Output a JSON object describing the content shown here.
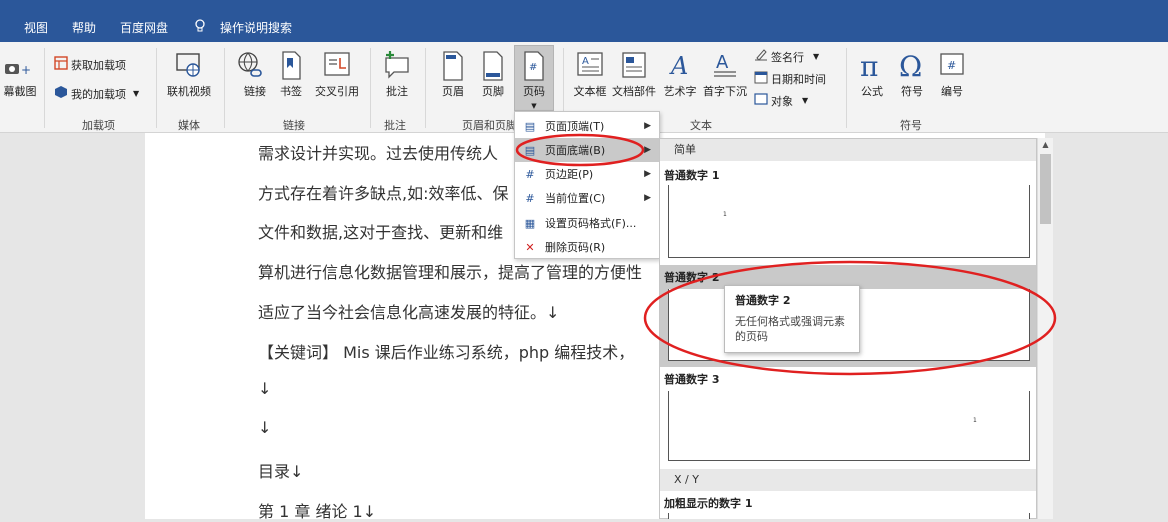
{
  "tabs": [
    "视图",
    "帮助",
    "百度网盘",
    "操作说明搜索"
  ],
  "ribbon": {
    "screenshot": "幕截图",
    "get_addins": "获取加载项",
    "my_addins": "我的加载项",
    "online_video": "联机视频",
    "link": "链接",
    "bookmark": "书签",
    "cross_ref": "交叉引用",
    "comment": "批注",
    "header": "页眉",
    "footer": "页脚",
    "page_number": "页码",
    "textbox": "文本框",
    "quick_parts": "文档部件",
    "wordart": "艺术字",
    "drop_cap": "首字下沉",
    "signature_line": "签名行",
    "datetime": "日期和时间",
    "object": "对象",
    "equation": "公式",
    "symbol": "符号",
    "number": "编号",
    "groups": {
      "addins": "加载项",
      "media": "媒体",
      "links": "链接",
      "comments": "批注",
      "header_footer": "页眉和页脚",
      "text": "文本",
      "symbols": "符号"
    }
  },
  "document": {
    "lines": [
      "需求设计并实现。过去使用传统人",
      "方式存在着许多缺点,如:效率低、保",
      "文件和数据,这对于查找、更新和维",
      "算机进行信息化数据管理和展示，提高了管理的方便性",
      "适应了当今社会信息化高速发展的特征。↓",
      "【关键词】  Mis 课后作业练习系统，php 编程技术，",
      "↓",
      "↓",
      "目录↓",
      "第 1 章  绪论 1↓"
    ]
  },
  "menu": {
    "items": [
      {
        "label": "页面顶端(T)",
        "submenu": true
      },
      {
        "label": "页面底端(B)",
        "submenu": true
      },
      {
        "label": "页边距(P)",
        "submenu": true
      },
      {
        "label": "当前位置(C)",
        "submenu": true
      },
      {
        "label": "设置页码格式(F)...",
        "submenu": false
      },
      {
        "label": "删除页码(R)",
        "submenu": false
      }
    ]
  },
  "gallery": {
    "section_simple": "简单",
    "section_xy": "X / Y",
    "items": [
      {
        "name": "普通数字 1",
        "sample": "1"
      },
      {
        "name": "普通数字 2",
        "sample": "1"
      },
      {
        "name": "普通数字 3",
        "sample": "1"
      },
      {
        "name": "加粗显示的数字 1",
        "sample": ""
      }
    ]
  },
  "tooltip": {
    "title": "普通数字 2",
    "description": "无任何格式或强调元素的页码"
  },
  "colors": {
    "title_bar": "#2b579a",
    "annotation": "#e02020"
  }
}
